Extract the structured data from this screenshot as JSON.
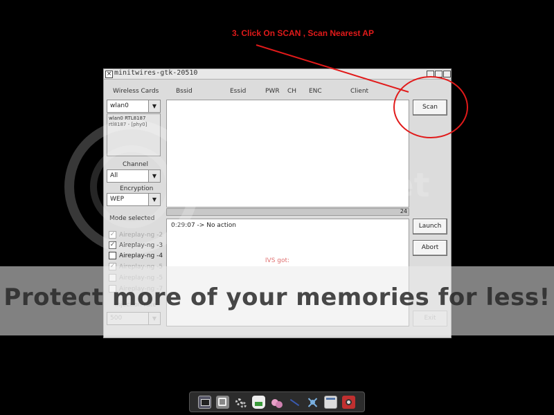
{
  "annotation": {
    "text": "3. Click On SCAN , Scan Nearest AP",
    "color": "#e11a1a"
  },
  "window": {
    "title": "minitwires-gtk-20510"
  },
  "left_panel": {
    "wireless_cards_label": "Wireless Cards",
    "interface_value": "wlan0",
    "interface_info": "wlan0 RTL8187 rtl8187 - [phy0]",
    "channel_label": "Channel",
    "channel_value": "All",
    "encryption_label": "Encryption",
    "encryption_value": "WEP",
    "mode_label": "Mode selected",
    "modes": [
      {
        "label": "Aireplay-ng -2",
        "checked": true,
        "enabled": false
      },
      {
        "label": "Aireplay-ng -3",
        "checked": true,
        "enabled": true
      },
      {
        "label": "Aireplay-ng -4",
        "checked": false,
        "enabled": true
      },
      {
        "label": "Aireplay-ng -5",
        "checked": true,
        "enabled": false
      },
      {
        "label": "Aireplay-ng -5",
        "checked": false,
        "enabled": false
      },
      {
        "label": "Aireplay-ng -7",
        "checked": false,
        "enabled": false
      }
    ],
    "injection_rate_label": "Injection rate",
    "injection_rate_value": "500"
  },
  "ap_table": {
    "columns": [
      "Bssid",
      "Essid",
      "PWR",
      "CH",
      "ENC",
      "Client"
    ]
  },
  "progress": {
    "count": "24"
  },
  "log": {
    "line": "0:29:07 -> No action"
  },
  "buttons": {
    "scan": "Scan",
    "launch": "Launch",
    "abort": "Abort",
    "exit": "Exit"
  },
  "status": {
    "ivs": "IVS got:"
  },
  "watermark": {
    "brand": "photobucket",
    "tagline": "Protect more of your memories for less!"
  },
  "taskbar": {
    "icons": [
      "terminal-icon",
      "settings-icon",
      "gears-icon",
      "package-icon",
      "dots-icon",
      "wire-icon",
      "network-icon",
      "window-icon",
      "camera-icon"
    ]
  }
}
